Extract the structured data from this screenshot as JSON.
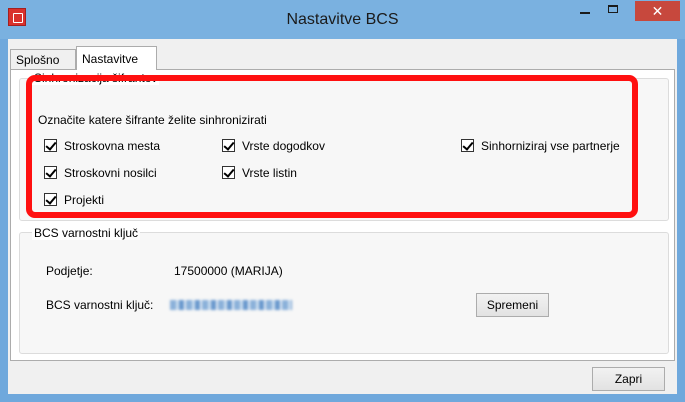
{
  "window": {
    "title": "Nastavitve BCS",
    "close_glyph": "✕"
  },
  "tabs": [
    {
      "label": "Splošno"
    },
    {
      "label": "Nastavitve"
    }
  ],
  "sync_group": {
    "legend": "Sinhronizacija šifrantov",
    "prompt": "Označite katere šifrante želite sinhronizirati",
    "checkboxes": [
      {
        "label": "Stroskovna mesta",
        "checked": true
      },
      {
        "label": "Vrste dogodkov",
        "checked": true
      },
      {
        "label": "Sinhorniziraj vse partnerje",
        "checked": true
      },
      {
        "label": "Stroskovni nosilci",
        "checked": true
      },
      {
        "label": "Vrste listin",
        "checked": true
      },
      {
        "label": "Projekti",
        "checked": true
      }
    ]
  },
  "key_group": {
    "legend": "BCS varnostni ključ",
    "company_label": "Podjetje:",
    "company_value": "17500000  (MARIJA)",
    "key_label": "BCS varnostni ključ:",
    "save_button": "Spremeni"
  },
  "footer": {
    "close_button": "Zapri"
  },
  "colors": {
    "highlight": "#ff1010",
    "titlebar": "#7ab1e0",
    "close_button": "#c7483d"
  }
}
